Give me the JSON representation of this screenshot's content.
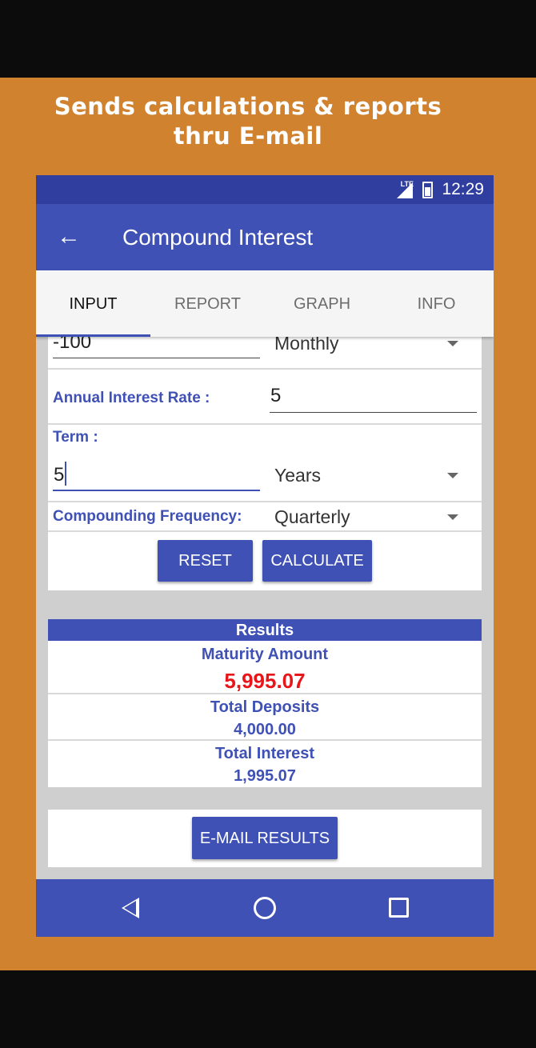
{
  "promo": {
    "headline_line1": "Sends calculations & reports",
    "headline_line2": "thru E-mail"
  },
  "status_bar": {
    "network": "LTE",
    "time": "12:29"
  },
  "app_bar": {
    "back_icon": "arrow-left-icon",
    "title": "Compound Interest"
  },
  "tabs": [
    {
      "label": "INPUT",
      "active": true
    },
    {
      "label": "REPORT",
      "active": false
    },
    {
      "label": "GRAPH",
      "active": false
    },
    {
      "label": "INFO",
      "active": false
    }
  ],
  "form": {
    "deposit_value": "-100",
    "deposit_frequency": "Monthly",
    "rate_label": "Annual Interest Rate :",
    "rate_value": "5",
    "term_label": "Term :",
    "term_value": "5",
    "term_unit": "Years",
    "compounding_label": "Compounding Frequency:",
    "compounding_value": "Quarterly",
    "reset_label": "RESET",
    "calculate_label": "CALCULATE"
  },
  "results": {
    "header": "Results",
    "maturity_label": "Maturity Amount",
    "maturity_value": "5,995.07",
    "deposits_label": "Total Deposits",
    "deposits_value": "4,000.00",
    "interest_label": "Total Interest",
    "interest_value": "1,995.07",
    "email_label": "E-MAIL RESULTS"
  },
  "colors": {
    "primary": "#3f51b5",
    "primary_dark": "#303f9f",
    "promo_background": "#d0822f",
    "highlight_value": "#e8161b"
  },
  "nav_bar": {
    "icons": [
      "back-triangle-icon",
      "home-circle-icon",
      "recents-square-icon"
    ]
  }
}
